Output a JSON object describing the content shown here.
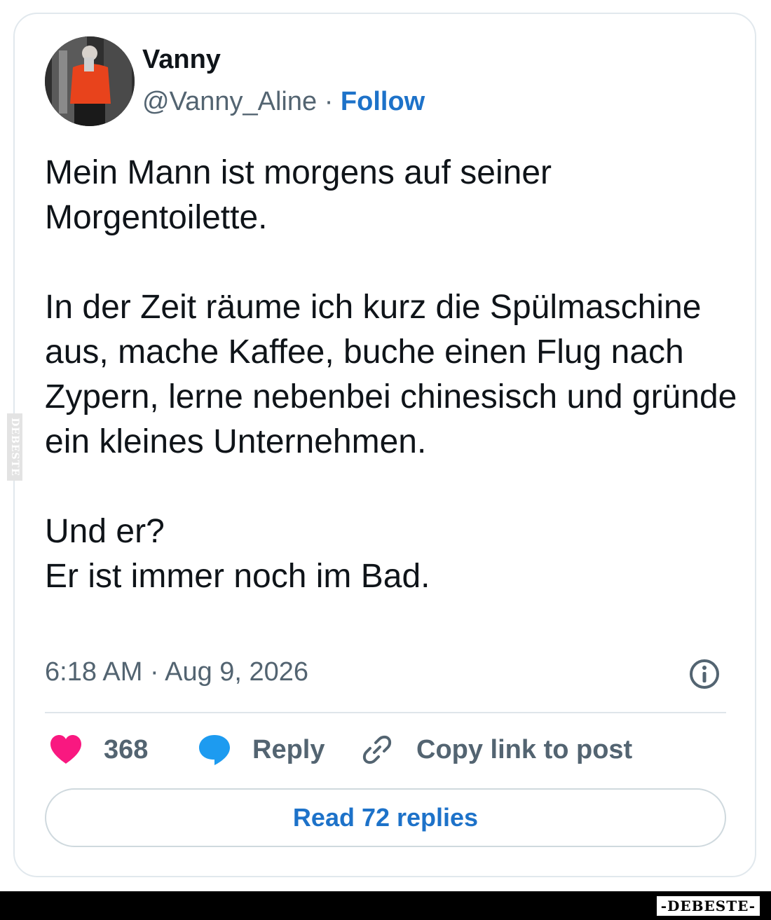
{
  "author": {
    "name": "Vanny",
    "handle": "@Vanny_Aline",
    "separator": " · ",
    "follow_label": "Follow"
  },
  "tweet": {
    "paragraphs": [
      "Mein Mann ist morgens auf seiner Morgentoilette.",
      "In der Zeit räume ich kurz die Spülmaschine aus, mache Kaffee, buche einen Flug nach Zypern, lerne nebenbei chinesisch und gründe ein kleines Unternehmen.",
      "Und er?\nEr ist immer noch im Bad."
    ],
    "timestamp": "6:18 AM · Aug 9, 2026"
  },
  "actions": {
    "like_count": "368",
    "reply_label": "Reply",
    "copy_link_label": "Copy link to post"
  },
  "read_replies_label": "Read 72 replies",
  "watermark": {
    "side_text": "DEBESTE",
    "footer_text": "-DEBESTE-"
  },
  "colors": {
    "accent": "#1d72c9",
    "like": "#f91880",
    "reply_icon": "#1d9bf0",
    "muted": "#536471"
  },
  "icons": {
    "info": "info-circle-icon",
    "like": "heart-icon",
    "reply": "speech-bubble-icon",
    "copy": "link-icon"
  }
}
